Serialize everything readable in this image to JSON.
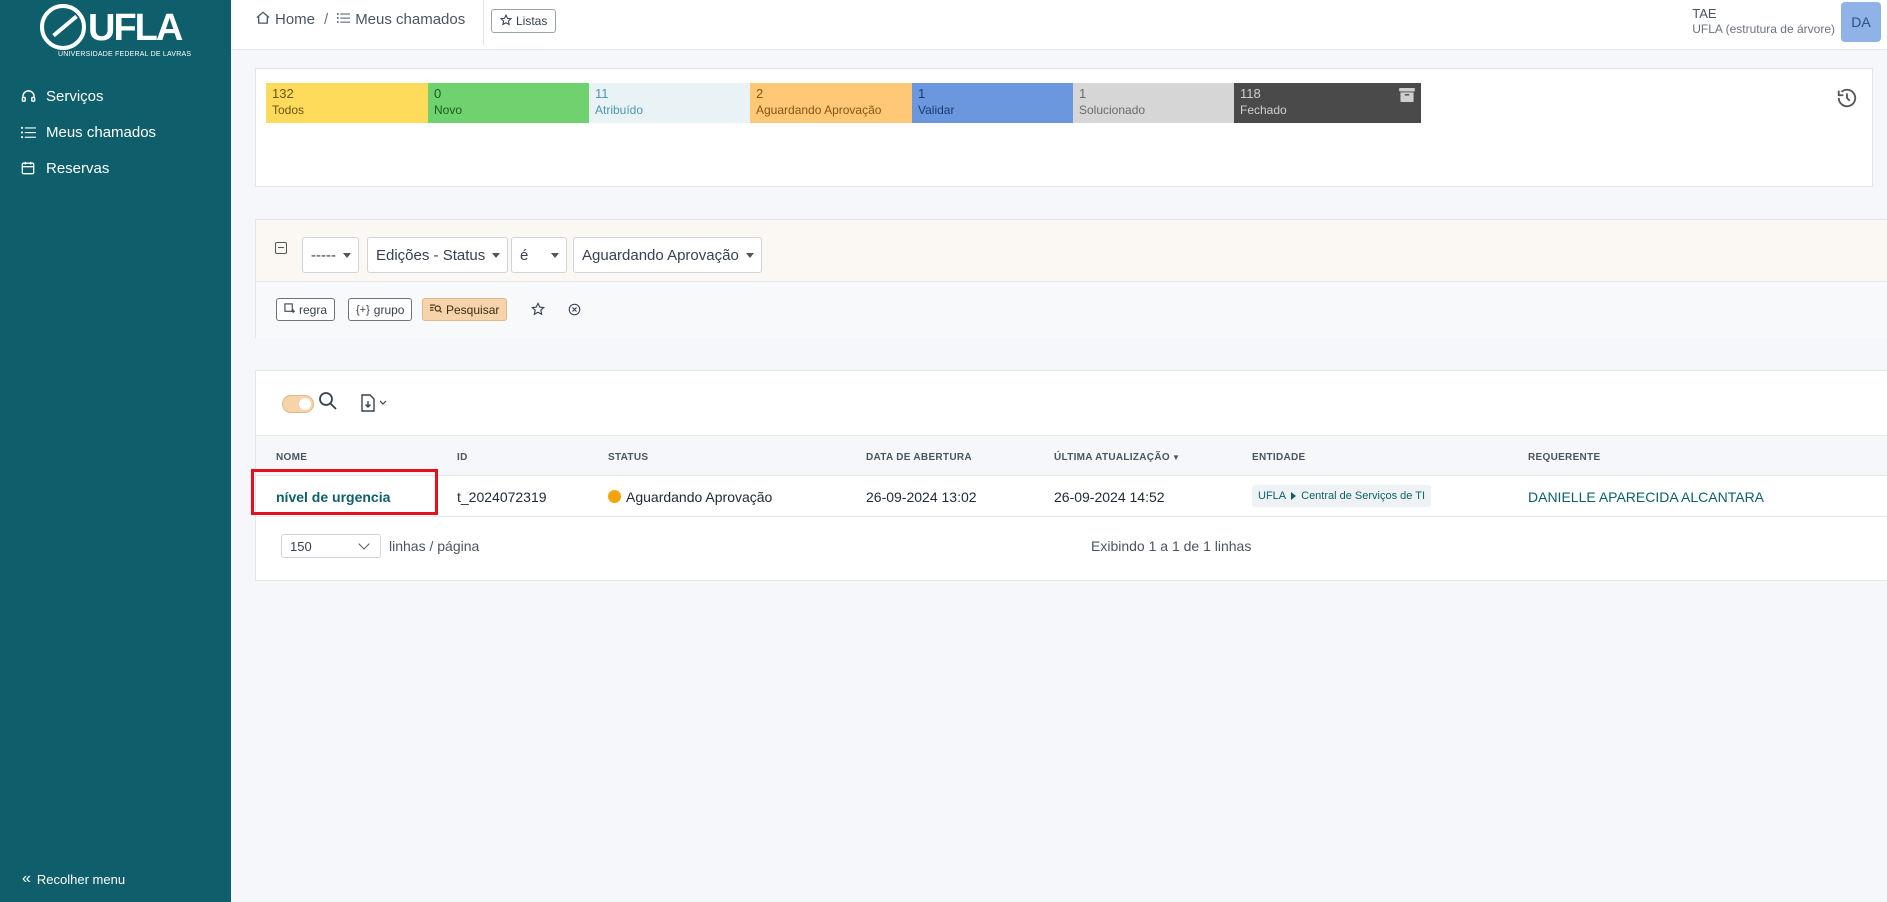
{
  "sidebar": {
    "logo_text": "UFLA",
    "logo_sub": "UNIVERSIDADE FEDERAL DE LAVRAS",
    "items": [
      {
        "label": "Serviços"
      },
      {
        "label": "Meus chamados"
      },
      {
        "label": "Reservas"
      }
    ],
    "collapse_label": "Recolher menu"
  },
  "header": {
    "breadcrumb": {
      "home": "Home",
      "sep": "/",
      "current": "Meus chamados"
    },
    "lists_label": "Listas",
    "profile": {
      "name": "TAE",
      "entity": "UFLA (estrutura de árvore)",
      "initials": "DA"
    }
  },
  "tiles": [
    {
      "count": "132",
      "label": "Todos",
      "bg": "#fedb5b",
      "fg": "#6b5510",
      "icon": ""
    },
    {
      "count": "0",
      "label": "Novo",
      "bg": "#6fd26f",
      "fg": "#1f5a1f",
      "icon": "exclamation-circle-icon"
    },
    {
      "count": "11",
      "label": "Atribuído",
      "bg": "#e9f3f5",
      "fg": "#4f93b5",
      "icon": "users-icon"
    },
    {
      "count": "2",
      "label": "Aguardando Aprovação",
      "bg": "#fec877",
      "fg": "#8a5412",
      "icon": "pause-circle-icon"
    },
    {
      "count": "1",
      "label": "Validar",
      "bg": "#6a97dd",
      "fg": "#1e3a70",
      "icon": "eye-icon"
    },
    {
      "count": "1",
      "label": "Solucionado",
      "bg": "#d6d6d6",
      "fg": "#6b6b6b",
      "icon": "check-square-icon"
    },
    {
      "count": "118",
      "label": "Fechado",
      "bg": "#4a4a4a",
      "fg": "#cfcfcf",
      "icon": "archive-icon"
    }
  ],
  "criteria": {
    "link": "-----",
    "field": "Edições - Status",
    "operator": "é",
    "value": "Aguardando Aprovação",
    "rule_btn": "regra",
    "group_btn": "grupo",
    "search_btn": "Pesquisar"
  },
  "table": {
    "columns": [
      "NOME",
      "ID",
      "STATUS",
      "DATA DE ABERTURA",
      "ÚLTIMA ATUALIZAÇÃO",
      "ENTIDADE",
      "REQUERENTE"
    ],
    "rows": [
      {
        "name": "nível de urgencia",
        "id": "t_2024072319",
        "status": "Aguardando Aprovação",
        "opened": "26-09-2024 13:02",
        "updated": "26-09-2024 14:52",
        "entity_root": "UFLA",
        "entity_child": "Central de Serviços de TI",
        "requester": "DANIELLE APARECIDA ALCANTARA"
      }
    ]
  },
  "pager": {
    "per_page": "150",
    "per_page_label": "linhas / página",
    "count_text": "Exibindo 1 a 1 de 1 linhas"
  }
}
